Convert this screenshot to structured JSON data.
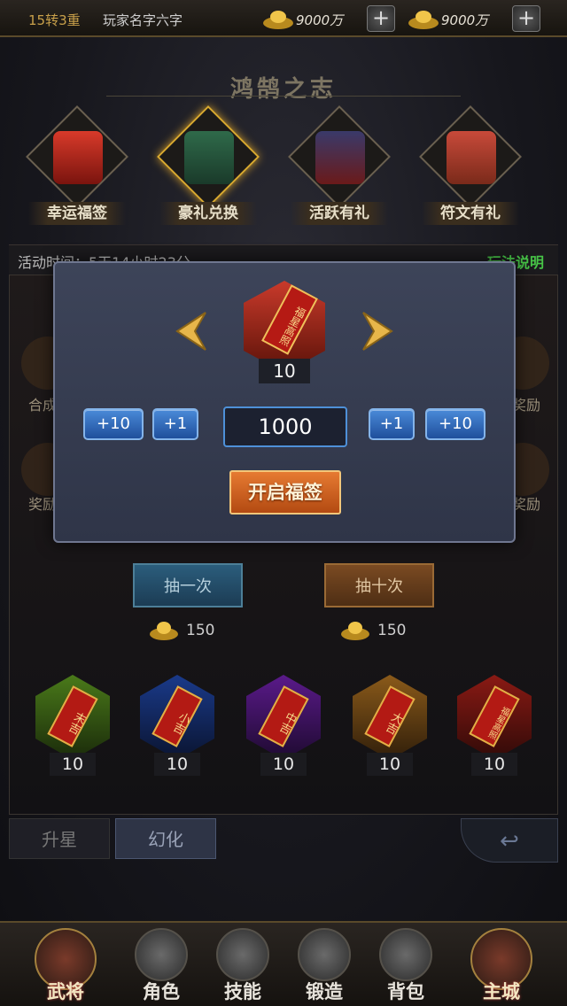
{
  "topbar": {
    "rank": "15转3重",
    "player_name": "玩家名字六字",
    "currency_1": {
      "amount": "9000万",
      "icon": "gold-ingot-icon"
    },
    "currency_2": {
      "amount": "9000万",
      "icon": "gold-ingot-icon"
    },
    "plus": "+"
  },
  "banner": {
    "title": "鸿鹄之志"
  },
  "activity_tabs": [
    {
      "label": "幸运福签",
      "icon": "lucky-lot-icon",
      "active": false
    },
    {
      "label": "豪礼兑换",
      "icon": "gift-exchange-icon",
      "active": true
    },
    {
      "label": "活跃有礼",
      "icon": "active-gift-icon",
      "active": false
    },
    {
      "label": "符文有礼",
      "icon": "rune-gift-icon",
      "active": false
    }
  ],
  "activity": {
    "time_text": "活动时间：5天14小时23分",
    "rules_link": "玩法说明"
  },
  "side_labels": {
    "left_top": "合成",
    "left_bottom": "奖励",
    "right_top": "奖励",
    "right_bottom": "奖励"
  },
  "draw": {
    "once_label": "抽一次",
    "ten_label": "抽十次",
    "once_cost": "150",
    "ten_cost": "150"
  },
  "lots": [
    {
      "name": "末吉",
      "count": "10",
      "color": "#4a7a1a"
    },
    {
      "name": "小吉",
      "count": "10",
      "color": "#1a3a8a"
    },
    {
      "name": "中吉",
      "count": "10",
      "color": "#5a1a8a"
    },
    {
      "name": "大吉",
      "count": "10",
      "color": "#8a5a1a"
    },
    {
      "name": "福星高照",
      "count": "10",
      "color": "#8a1a14"
    }
  ],
  "subtabs": {
    "upgrade_star": "升星",
    "transform": "幻化"
  },
  "back_icon": "return-icon",
  "bottom_nav": [
    {
      "label": "武将",
      "icon": "general-icon"
    },
    {
      "label": "角色",
      "icon": "helmet-icon"
    },
    {
      "label": "技能",
      "icon": "swirl-icon"
    },
    {
      "label": "锻造",
      "icon": "anvil-icon"
    },
    {
      "label": "背包",
      "icon": "bag-icon"
    },
    {
      "label": "主城",
      "icon": "city-icon"
    }
  ],
  "modal": {
    "prize_name": "福星高照",
    "prize_count": "10",
    "minus10": "+10",
    "minus1": "+1",
    "quantity": "1000",
    "plus1": "+1",
    "plus10": "+10",
    "open_label": "开启福签"
  }
}
